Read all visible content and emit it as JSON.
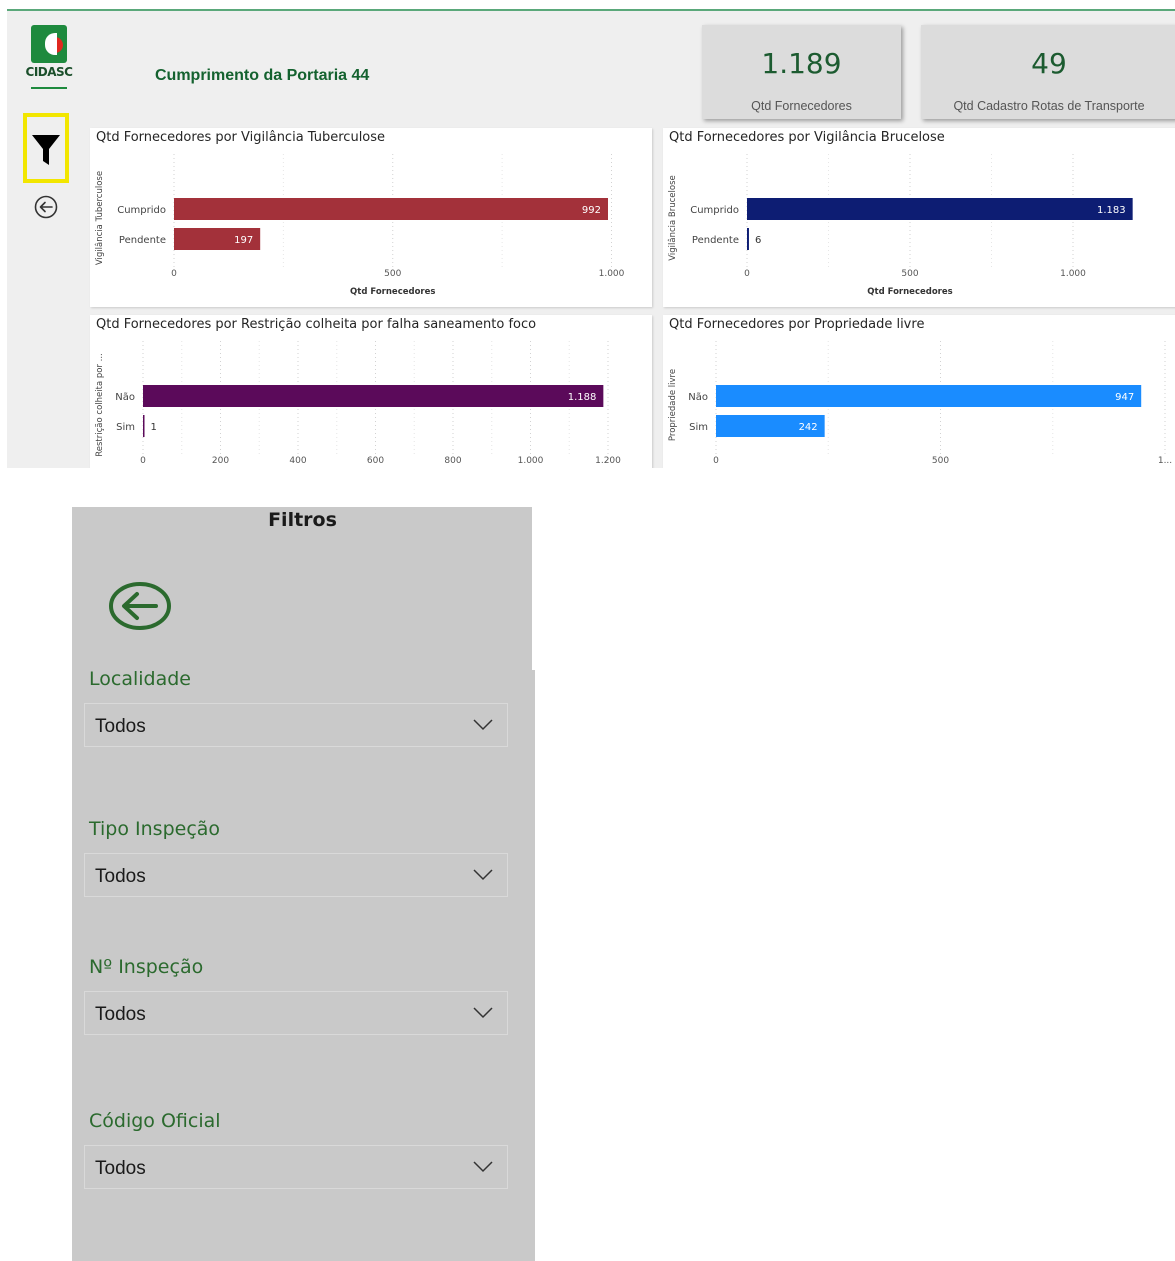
{
  "header": {
    "logo_text": "CIDASC",
    "title": "Cumprimento da Portaria 44"
  },
  "kpis": [
    {
      "value": "1.189",
      "label": "Qtd Fornecedores"
    },
    {
      "value": "49",
      "label": "Qtd Cadastro Rotas de Transporte"
    }
  ],
  "icons": {
    "filter": "filter-icon",
    "back": "back-arrow-circle-icon",
    "chevron": "chevron-down-icon"
  },
  "colors": {
    "brand_green": "#1e8a3e",
    "highlight_yellow": "#f2e600",
    "tuberculose_bar": "#a3313a",
    "brucelose_bar": "#0d1d73",
    "restricao_bar": "#5b0a5a",
    "propriedade_bar": "#1a8cff"
  },
  "chart_data": [
    {
      "type": "bar",
      "orientation": "horizontal",
      "title": "Qtd Fornecedores por Vigilância Tuberculose",
      "xlabel": "Qtd Fornecedores",
      "ylabel": "Vigilância Tuberculose",
      "categories": [
        "Cumprido",
        "Pendente"
      ],
      "values": [
        992,
        197
      ],
      "value_labels": [
        "992",
        "197"
      ],
      "xticks": [
        0,
        500,
        1000
      ],
      "xtick_labels": [
        "0",
        "500",
        "1.000"
      ],
      "xlim": [
        0,
        1000
      ],
      "color": "#a3313a"
    },
    {
      "type": "bar",
      "orientation": "horizontal",
      "title": "Qtd Fornecedores por Vigilância Brucelose",
      "xlabel": "Qtd Fornecedores",
      "ylabel": "Vigilância Brucelose",
      "categories": [
        "Cumprido",
        "Pendente"
      ],
      "values": [
        1183,
        6
      ],
      "value_labels": [
        "1.183",
        "6"
      ],
      "xticks": [
        0,
        500,
        1000
      ],
      "xtick_labels": [
        "0",
        "500",
        "1.000"
      ],
      "xlim": [
        0,
        1200
      ],
      "color": "#0d1d73"
    },
    {
      "type": "bar",
      "orientation": "horizontal",
      "title": "Qtd Fornecedores por Restrição colheita por falha saneamento foco",
      "xlabel": "Qtd Fornecedores",
      "ylabel": "Restrição colheita por ...",
      "categories": [
        "Não",
        "Sim"
      ],
      "values": [
        1188,
        1
      ],
      "value_labels": [
        "1.188",
        "1"
      ],
      "xticks": [
        0,
        200,
        400,
        600,
        800,
        1000,
        1200
      ],
      "xtick_labels": [
        "0",
        "200",
        "400",
        "600",
        "800",
        "1.000",
        "1.200"
      ],
      "xlim": [
        0,
        1200
      ],
      "color": "#5b0a5a"
    },
    {
      "type": "bar",
      "orientation": "horizontal",
      "title": "Qtd Fornecedores por Propriedade livre",
      "xlabel": "Qtd Fornecedores",
      "ylabel": "Propriedade livre",
      "categories": [
        "Não",
        "Sim"
      ],
      "values": [
        947,
        242
      ],
      "value_labels": [
        "947",
        "242"
      ],
      "xticks": [
        0,
        500,
        1000
      ],
      "xtick_labels": [
        "0",
        "500",
        "1..."
      ],
      "xlim": [
        0,
        1000
      ],
      "color": "#1a8cff"
    }
  ],
  "filters_panel": {
    "title": "Filtros",
    "filters": [
      {
        "label": "Localidade",
        "value": "Todos"
      },
      {
        "label": "Tipo Inspeção",
        "value": "Todos"
      },
      {
        "label": "Nº Inspeção",
        "value": "Todos"
      },
      {
        "label": "Código Oficial",
        "value": "Todos"
      }
    ]
  }
}
